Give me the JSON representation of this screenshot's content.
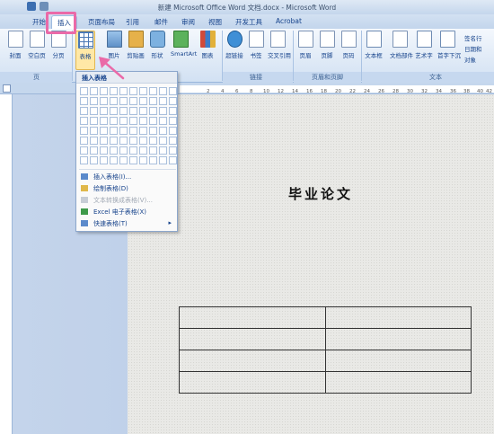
{
  "window": {
    "title": "新建 Microsoft Office Word 文档.docx - Microsoft Word"
  },
  "tabs": [
    {
      "label": "开始"
    },
    {
      "label": "插入"
    },
    {
      "label": "页面布局"
    },
    {
      "label": "引用"
    },
    {
      "label": "邮件"
    },
    {
      "label": "审阅"
    },
    {
      "label": "视图"
    },
    {
      "label": "开发工具"
    },
    {
      "label": "Acrobat"
    }
  ],
  "ribbon": {
    "buttons": [
      {
        "label": "封面",
        "icon": "cover-page-icon"
      },
      {
        "label": "空白页",
        "icon": "blank-page-icon"
      },
      {
        "label": "分页",
        "icon": "page-break-icon"
      },
      {
        "label": "表格",
        "icon": "table-icon"
      },
      {
        "label": "图片",
        "icon": "picture-icon"
      },
      {
        "label": "剪贴画",
        "icon": "clip-art-icon"
      },
      {
        "label": "形状",
        "icon": "shapes-icon"
      },
      {
        "label": "SmartArt",
        "icon": "smartart-icon"
      },
      {
        "label": "图表",
        "icon": "chart-icon"
      },
      {
        "label": "超链接",
        "icon": "hyperlink-icon"
      },
      {
        "label": "书签",
        "icon": "bookmark-icon"
      },
      {
        "label": "交叉引用",
        "icon": "cross-reference-icon"
      },
      {
        "label": "页眉",
        "icon": "header-icon"
      },
      {
        "label": "页脚",
        "icon": "footer-icon"
      },
      {
        "label": "页码",
        "icon": "page-number-icon"
      },
      {
        "label": "文本框",
        "icon": "text-box-icon"
      },
      {
        "label": "文档部件",
        "icon": "quick-parts-icon"
      },
      {
        "label": "艺术字",
        "icon": "wordart-icon"
      },
      {
        "label": "首字下沉",
        "icon": "drop-cap-icon"
      }
    ],
    "small_items": [
      "签名行",
      "日期和",
      "对象"
    ],
    "groups": [
      "页",
      "链接",
      "页眉和页脚",
      "文本"
    ]
  },
  "dropdown": {
    "header": "插入表格",
    "grid": {
      "columns": 10,
      "rows": 8
    },
    "items": [
      {
        "label": "插入表格(I)...",
        "disabled": false
      },
      {
        "label": "绘制表格(D)",
        "disabled": false
      },
      {
        "label": "文本转换成表格(V)...",
        "disabled": true
      },
      {
        "label": "Excel 电子表格(X)",
        "disabled": false
      },
      {
        "label": "快速表格(T)",
        "disabled": false,
        "has_submenu": true
      }
    ]
  },
  "ruler": {
    "ticks": [
      "2",
      "4",
      "6",
      "8",
      "10",
      "12",
      "14",
      "16",
      "18",
      "20",
      "22",
      "24",
      "26",
      "28",
      "30",
      "32",
      "34",
      "36",
      "38",
      "40",
      "42"
    ]
  },
  "document": {
    "title": "毕业论文",
    "table": {
      "rows": 4,
      "columns": 2
    }
  },
  "colors": {
    "highlight": "#ea6aa8",
    "ribbon_accent": "#ffe8a6",
    "text": "#15428b"
  }
}
